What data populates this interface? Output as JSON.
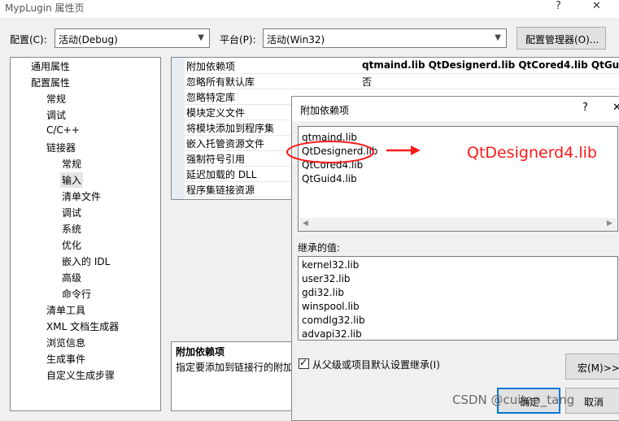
{
  "window": {
    "title": "MypLugin 属性页",
    "help_icon": "?",
    "close_icon": "✕"
  },
  "config_row": {
    "config_label": "配置(C):",
    "config_value": "活动(Debug)",
    "platform_label": "平台(P):",
    "platform_value": "活动(Win32)",
    "manager_button": "配置管理器(O)..."
  },
  "tree": {
    "items": [
      {
        "label": "通用属性"
      },
      {
        "label": "配置属性"
      },
      {
        "label": "常规"
      },
      {
        "label": "调试"
      },
      {
        "label": "C/C++"
      },
      {
        "label": "链接器"
      },
      {
        "label": "常规"
      },
      {
        "label": "输入"
      },
      {
        "label": "清单文件"
      },
      {
        "label": "调试"
      },
      {
        "label": "系统"
      },
      {
        "label": "优化"
      },
      {
        "label": "嵌入的 IDL"
      },
      {
        "label": "高级"
      },
      {
        "label": "命令行"
      },
      {
        "label": "清单工具"
      },
      {
        "label": "XML 文档生成器"
      },
      {
        "label": "浏览信息"
      },
      {
        "label": "生成事件"
      },
      {
        "label": "自定义生成步骤"
      }
    ]
  },
  "grid": {
    "rows": [
      {
        "name": "附加依赖项",
        "value": "qtmaind.lib QtDesignerd.lib QtCored4.lib QtGuid"
      },
      {
        "name": "忽略所有默认库",
        "value": "否"
      },
      {
        "name": "忽略特定库",
        "value": ""
      },
      {
        "name": "模块定义文件",
        "value": ""
      },
      {
        "name": "将模块添加到程序集",
        "value": ""
      },
      {
        "name": "嵌入托管资源文件",
        "value": ""
      },
      {
        "name": "强制符号引用",
        "value": ""
      },
      {
        "name": "延迟加载的 DLL",
        "value": ""
      },
      {
        "name": "程序集链接资源",
        "value": ""
      }
    ]
  },
  "description": {
    "title": "附加依赖项",
    "text": "指定要添加到链接行的附加"
  },
  "dialog": {
    "title": "附加依赖项",
    "help_icon": "?",
    "close_icon": "✕",
    "deps": [
      "qtmaind.lib",
      "QtDesignerd.lib",
      "QtCored4.lib",
      "QtGuid4.lib"
    ],
    "inherited_label": "继承的值:",
    "inherited": [
      "kernel32.lib",
      "user32.lib",
      "gdi32.lib",
      "winspool.lib",
      "comdlg32.lib",
      "advapi32.lib"
    ],
    "inherit_checkbox_label": "从父级或项目默认设置继承(I)",
    "inherit_checked": true,
    "macro_button": "宏(M)>>",
    "ok_button": "确定",
    "cancel_button": "取消"
  },
  "annotation": {
    "text": "QtDesignerd4.lib",
    "color": "#ff1a1a"
  },
  "watermark": "CSDN @cuitao_tang"
}
